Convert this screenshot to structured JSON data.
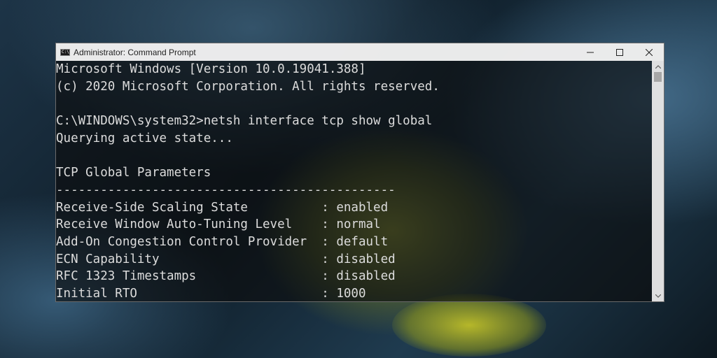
{
  "window": {
    "title": "Administrator: Command Prompt",
    "icon_text": "C:\\"
  },
  "controls": {
    "minimize_icon": "minimize-icon",
    "maximize_icon": "maximize-icon",
    "close_icon": "close-icon"
  },
  "console": {
    "lines": [
      "Microsoft Windows [Version 10.0.19041.388]",
      "(c) 2020 Microsoft Corporation. All rights reserved.",
      "",
      "C:\\WINDOWS\\system32>netsh interface tcp show global",
      "Querying active state...",
      "",
      "TCP Global Parameters",
      "----------------------------------------------",
      "Receive-Side Scaling State          : enabled",
      "Receive Window Auto-Tuning Level    : normal",
      "Add-On Congestion Control Provider  : default",
      "ECN Capability                      : disabled",
      "RFC 1323 Timestamps                 : disabled",
      "Initial RTO                         : 1000"
    ]
  },
  "colors": {
    "console_text": "#dcdcdc",
    "titlebar_bg": "#f5f5f5",
    "scrollbar_thumb": "#a6a6a6"
  }
}
